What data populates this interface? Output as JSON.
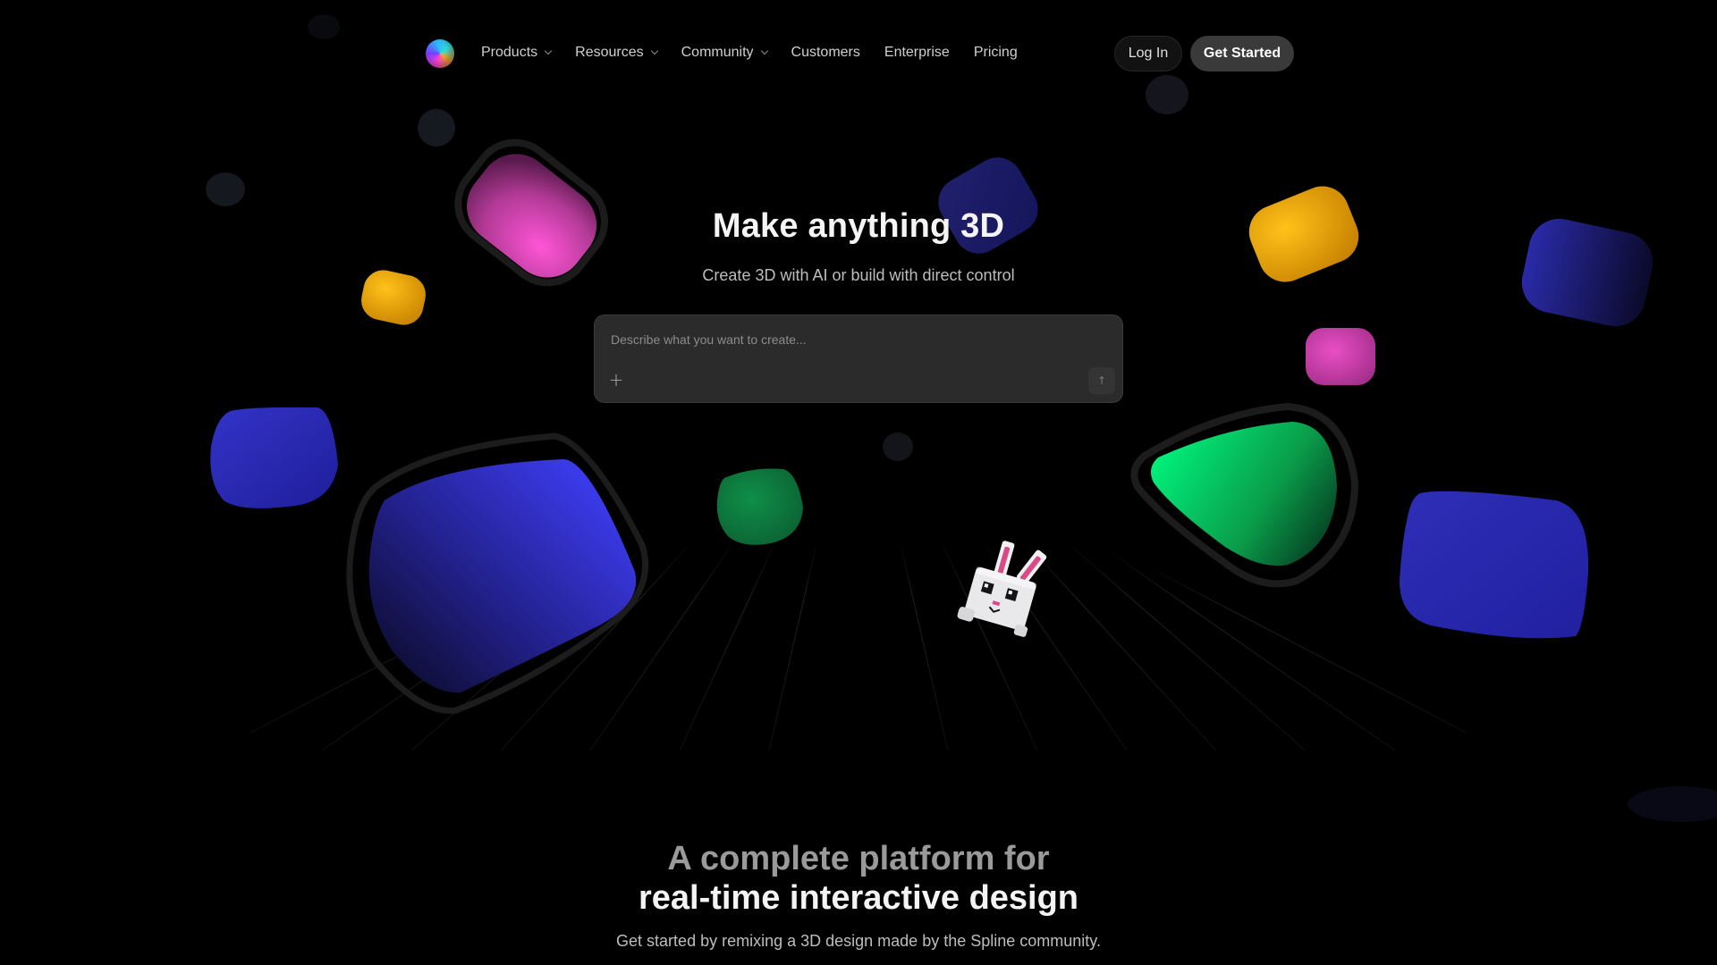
{
  "nav": {
    "logo_icon": "spline-logo-icon",
    "items": [
      {
        "label": "Products",
        "dropdown": true
      },
      {
        "label": "Resources",
        "dropdown": true
      },
      {
        "label": "Community",
        "dropdown": true
      },
      {
        "label": "Customers",
        "dropdown": false
      },
      {
        "label": "Enterprise",
        "dropdown": false
      },
      {
        "label": "Pricing",
        "dropdown": false
      }
    ],
    "login_label": "Log In",
    "get_started_label": "Get Started"
  },
  "hero": {
    "title": "Make anything 3D",
    "subtitle": "Create 3D with AI or build with direct control",
    "prompt": {
      "placeholder": "Describe what you want to create...",
      "value": "",
      "add_icon": "plus-icon",
      "send_icon": "arrow-up-icon"
    }
  },
  "platform": {
    "heading_line1": "A complete platform for",
    "heading_line2": "real-time interactive design",
    "subtitle": "Get started by remixing a 3D design made by the Spline community."
  },
  "colors": {
    "background": "#000000",
    "magenta": "#e23fb0",
    "yellow": "#f5a800",
    "indigo": "#2a2ac0",
    "green": "#12c864"
  }
}
